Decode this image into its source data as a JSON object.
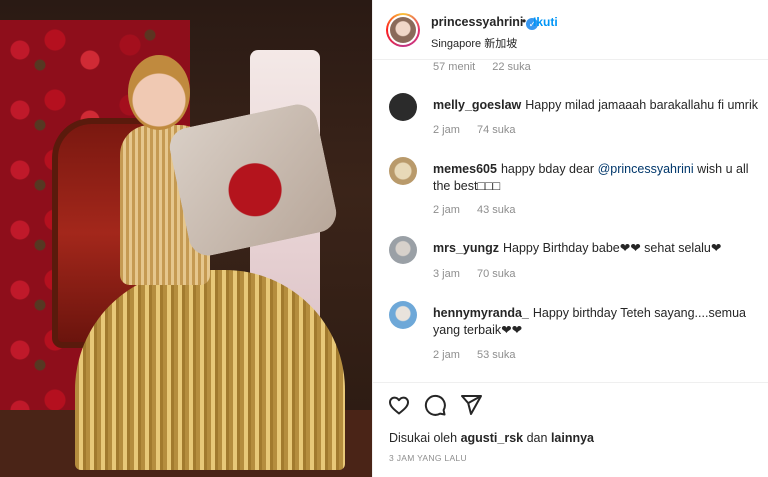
{
  "post": {
    "author": "princessyahrini",
    "follow_label": "Ikuti",
    "separator": "•",
    "location": "Singapore 新加坡"
  },
  "previous_comment": {
    "time": "57 menit",
    "likes": "22 suka"
  },
  "comments": [
    {
      "user": "melly_goeslaw",
      "text": "Happy milad jamaaah barakallahu fi umrik",
      "time": "2 jam",
      "likes": "74 suka",
      "avatar_color": "#2b2b2b"
    },
    {
      "user": "memes605",
      "text_before": "happy bday dear",
      "mention": "@princessyahrini",
      "text_after": "wish u all the best□□□",
      "time": "2 jam",
      "likes": "43 suka",
      "avatar_color": "#b99a6b"
    },
    {
      "user": "mrs_yungz",
      "text": "Happy Birthday babe❤❤ sehat selalu❤",
      "time": "3 jam",
      "likes": "70 suka",
      "avatar_color": "#9aa0a6"
    },
    {
      "user": "hennymyranda_",
      "text": "Happy birthday Teteh sayang....semua yang terbaik❤❤",
      "time": "2 jam",
      "likes": "53 suka",
      "avatar_color": "#6ea8d8"
    }
  ],
  "likes_line": {
    "prefix": "Disukai oleh",
    "user": "agusti_rsk",
    "middle": "dan",
    "suffix": "lainnya"
  },
  "time_ago": "3 JAM YANG LALU",
  "icons": {
    "like": "heart-icon",
    "comment": "comment-icon",
    "share": "share-icon",
    "verified": "verified-badge-icon"
  },
  "colors": {
    "link": "#0095f6",
    "verified": "#3897f0",
    "mention": "#00376b",
    "muted": "#8e8e8e"
  }
}
